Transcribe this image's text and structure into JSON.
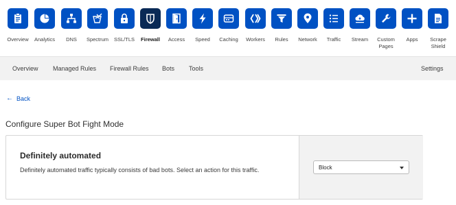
{
  "topnav": {
    "items": [
      {
        "label": "Overview",
        "icon": "clipboard-icon"
      },
      {
        "label": "Analytics",
        "icon": "pie-chart-icon"
      },
      {
        "label": "DNS",
        "icon": "network-tree-icon"
      },
      {
        "label": "Spectrum",
        "icon": "spectrum-shield-icon"
      },
      {
        "label": "SSL/TLS",
        "icon": "lock-icon"
      },
      {
        "label": "Firewall",
        "icon": "shield-icon"
      },
      {
        "label": "Access",
        "icon": "door-icon"
      },
      {
        "label": "Speed",
        "icon": "lightning-icon"
      },
      {
        "label": "Caching",
        "icon": "server-icon"
      },
      {
        "label": "Workers",
        "icon": "workers-chevrons-icon"
      },
      {
        "label": "Rules",
        "icon": "filter-icon"
      },
      {
        "label": "Network",
        "icon": "location-pin-icon"
      },
      {
        "label": "Traffic",
        "icon": "list-icon"
      },
      {
        "label": "Stream",
        "icon": "cloud-upload-icon"
      },
      {
        "label": "Custom\nPages",
        "icon": "wrench-icon"
      },
      {
        "label": "Apps",
        "icon": "plus-icon"
      },
      {
        "label": "Scrape\nShield",
        "icon": "document-icon"
      }
    ],
    "active": "Firewall"
  },
  "subnav": {
    "overview": "Overview",
    "managed_rules": "Managed Rules",
    "firewall_rules": "Firewall Rules",
    "bots": "Bots",
    "tools": "Tools",
    "settings": "Settings"
  },
  "back": {
    "label": "Back",
    "icon": "left-arrow-icon"
  },
  "page_title": "Configure Super Bot Fight Mode",
  "card": {
    "heading": "Definitely automated",
    "description": "Definitely automated traffic typically consists of bad bots. Select an action for this traffic.",
    "action_select": {
      "value": "Block"
    }
  },
  "colors": {
    "nav_icon_bg": "#0051c3",
    "nav_icon_active_bg": "#0a2a56",
    "link": "#0051c3",
    "subnav_bg": "#f2f2f2"
  }
}
